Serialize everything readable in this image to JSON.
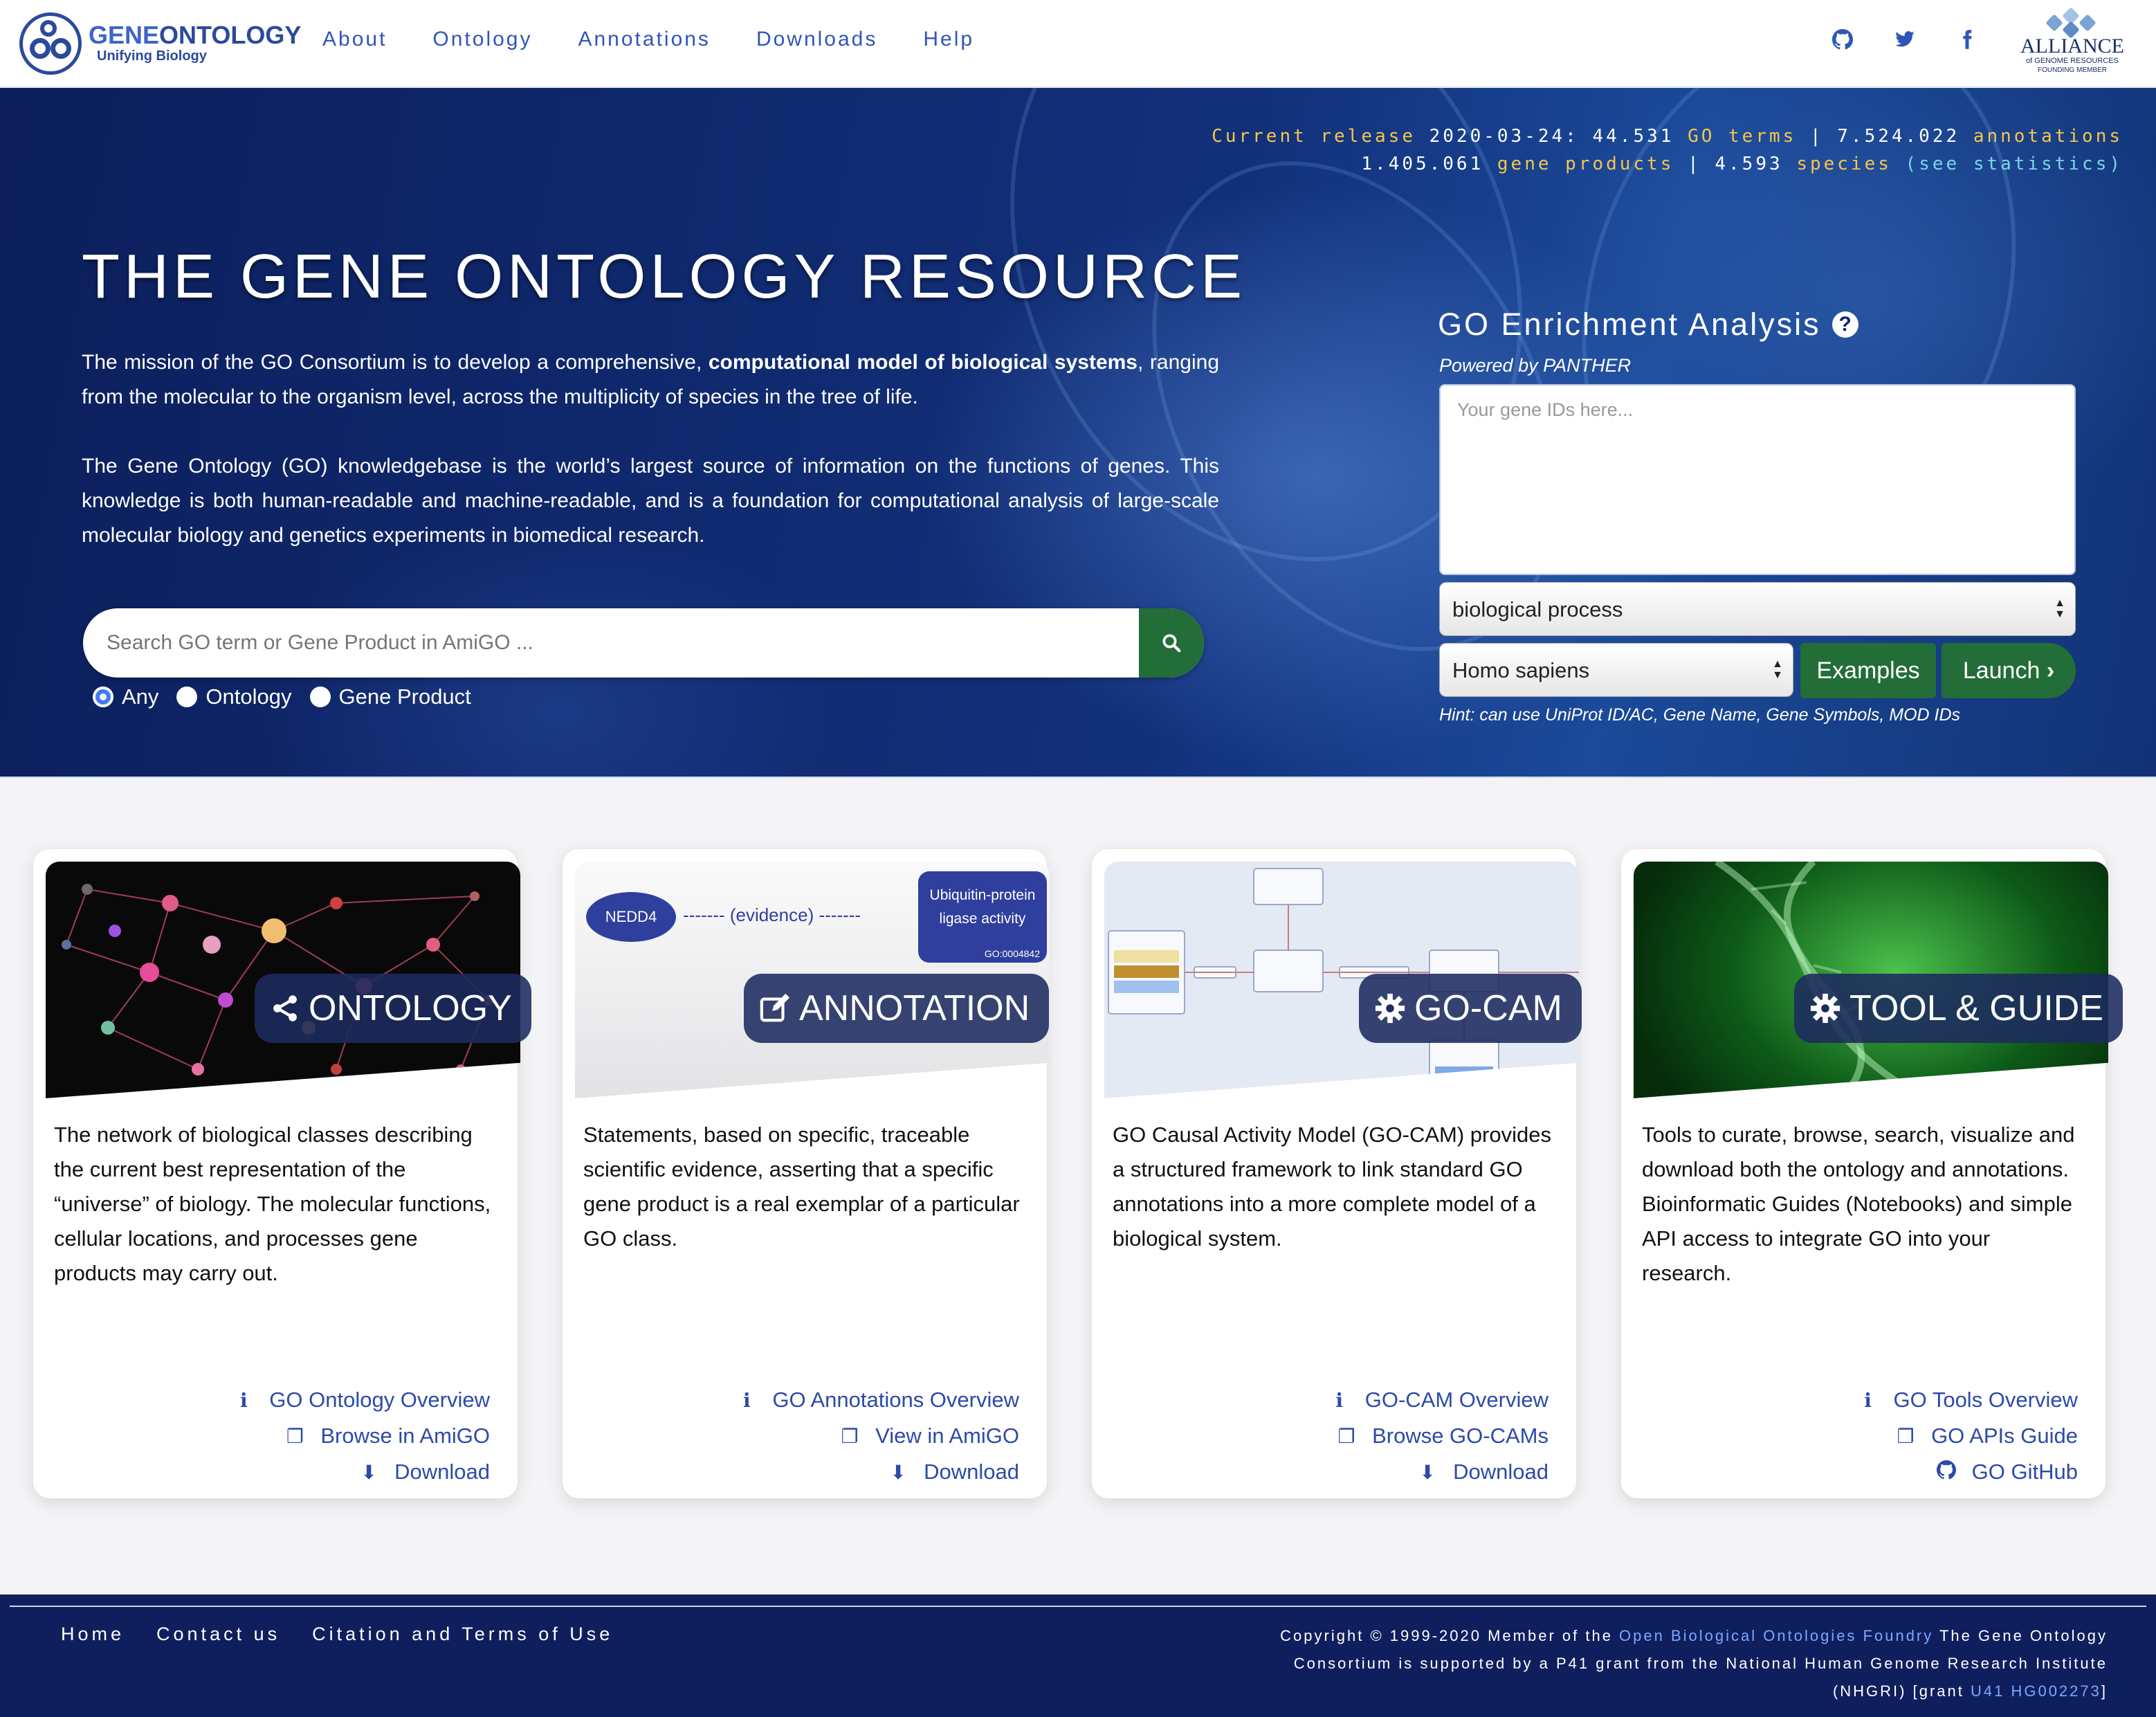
{
  "brand": {
    "title_a": "GENE",
    "title_b": "ONTOLOGY",
    "subtitle": "Unifying Biology"
  },
  "nav": {
    "items": [
      "About",
      "Ontology",
      "Annotations",
      "Downloads",
      "Help"
    ]
  },
  "nav_icons": [
    "github-icon",
    "twitter-icon",
    "facebook-icon"
  ],
  "alliance": {
    "name": "ALLIANCE",
    "line1": "of GENOME RESOURCES",
    "line2": "FOUNDING MEMBER"
  },
  "release": {
    "label": "Current release",
    "date": "2020-03-24:",
    "terms": "44.531",
    "terms_label": "GO terms",
    "sep": "|",
    "annotations": "7.524.022",
    "annotations_label": "annotations",
    "gene_products": "1.405.061",
    "gene_products_label": "gene products",
    "species": "4.593",
    "species_label": "species",
    "stats_link": "(see statistics)"
  },
  "hero": {
    "title": "THE GENE ONTOLOGY RESOURCE",
    "p1_a": "The mission of the GO Consortium is to develop a comprehensive, ",
    "p1_b": "computational model of biological systems",
    "p1_c": ", ranging from the molecular to the organism level, across the multiplicity of species in the tree of life.",
    "p2": "The Gene Ontology (GO) knowledgebase is the world’s largest source of information on the functions of genes. This knowledge is both human-readable and machine-readable, and is a foundation for computational analysis of large-scale molecular biology and genetics experiments in biomedical research.",
    "search_placeholder": "Search GO term or Gene Product in AmiGO ...",
    "radios": [
      "Any",
      "Ontology",
      "Gene Product"
    ],
    "radio_selected": "Any"
  },
  "enrichment": {
    "title": "GO Enrichment Analysis",
    "powered": "Powered by PANTHER",
    "placeholder": "Your gene IDs here...",
    "process": "biological process",
    "species": "Homo sapiens",
    "examples": "Examples",
    "launch": "Launch",
    "hint": "Hint: can use UniProt ID/AC, Gene Name, Gene Symbols, MOD IDs"
  },
  "cards": [
    {
      "badge": "ONTOLOGY",
      "text": "The network of biological classes describing the current best representation of the “universe” of biology. The molecular functions, cellular locations, and processes gene products may carry out.",
      "links": [
        "GO Ontology Overview",
        "Browse in AmiGO",
        "Download"
      ]
    },
    {
      "badge": "ANNOTATION",
      "text": "Statements, based on specific, traceable scientific evidence, asserting that a specific gene product is a real exemplar of a particular GO class.",
      "links": [
        "GO Annotations Overview",
        "View in AmiGO",
        "Download"
      ],
      "diagram": {
        "gene": "NEDD4",
        "evidence": "------- (evidence) -------",
        "term_line1": "Ubiquitin-protein",
        "term_line2": "ligase activity",
        "term_id": "GO:0004842"
      }
    },
    {
      "badge": "GO-CAM",
      "text": "GO Causal Activity Model (GO-CAM) provides a structured framework to link standard GO annotations into a more complete model of a biological system.",
      "links": [
        "GO-CAM Overview",
        "Browse GO-CAMs",
        "Download"
      ]
    },
    {
      "badge": "TOOL & GUIDE",
      "text": "Tools to curate, browse, search, visualize and download both the ontology and annotations. Bioinformatic Guides (Notebooks) and simple API access to integrate GO into your research.",
      "links": [
        "GO Tools Overview",
        "GO APIs Guide",
        "GO GitHub"
      ]
    }
  ],
  "footer": {
    "links": [
      "Home",
      "Contact us",
      "Citation and Terms of Use"
    ],
    "copy_a": "Copyright © 1999-2020 Member of the ",
    "copy_link1": "Open Biological Ontologies Foundry",
    "copy_b": " The Gene Ontology Consortium is supported by a P41 grant from the National Human Genome Research Institute (NHGRI) [grant ",
    "copy_link2": "U41 HG002273",
    "copy_c": "]"
  },
  "colors": {
    "nav_text": "#2f55b8",
    "hero_bg": "#0c1f5c",
    "green": "#236d38",
    "release_yellow": "#f7c54b",
    "release_cyan": "#79d6ea",
    "footer_bg": "#0f1f5e"
  }
}
